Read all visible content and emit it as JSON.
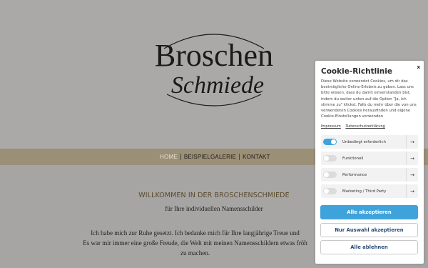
{
  "site": {
    "logo_line1": "Broschen",
    "logo_line2": "Schmiede",
    "nav": [
      {
        "label": "HOME"
      },
      {
        "label": "BEISPIELGALERIE"
      },
      {
        "label": "KONTAKT"
      }
    ],
    "welcome_heading": "WILLKOMMEN IN DER BROSCHENSCHMIEDE",
    "subtitle": "für Ihre individuellen Namensschilder",
    "paragraph_lines": [
      "Ich habe mich zur Ruhe gesetzt. Ich bedanke mich für Ihre langjährige Treue und",
      "Es war mir immer eine große Freude, die Welt mit meinen Namensschildern etwas fröh",
      "zu machen."
    ]
  },
  "cookie_panel": {
    "close_label": "x",
    "title": "Cookie-Richtlinie",
    "text": "Diese Website verwendet Cookies, um dir das bestmögliche Online-Erlebnis zu geben. Lass uns bitte wissen, dass du damit einverstanden bist, indem du weiter unten auf die Option \"Ja, ich stimme zu\" klickst. Falls du mehr über die von uns verwendeten Cookies herausfinden und eigene Cookie-Einstellungen verwenden",
    "links": {
      "imprint": "Impressum",
      "privacy": "Datenschutzerklärung"
    },
    "categories": [
      {
        "label": "Unbedingt erforderlich",
        "enabled": true
      },
      {
        "label": "Funktionell",
        "enabled": false
      },
      {
        "label": "Performance",
        "enabled": false
      },
      {
        "label": "Marketing / Third Party",
        "enabled": false
      }
    ],
    "arrow": "→",
    "buttons": {
      "accept_all": "Alle akzeptieren",
      "accept_selection": "Nur Auswahl akzeptieren",
      "reject_all": "Alle ablehnen"
    },
    "colors": {
      "accent": "#3fa3db"
    }
  },
  "colors": {
    "overlay_bg": "#aaa9a7",
    "nav_bg": "#9b8f78",
    "heading": "#5a4a2c"
  }
}
